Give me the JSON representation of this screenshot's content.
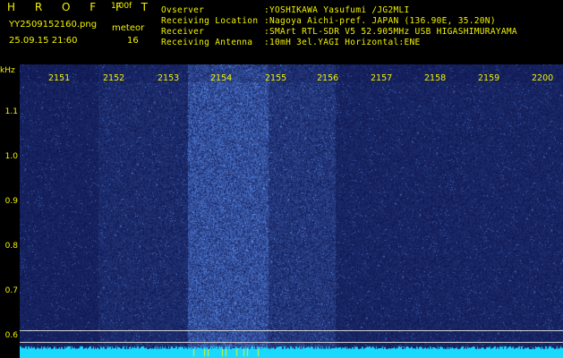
{
  "header": {
    "brand": "H R O F F T",
    "version": "1.00f",
    "filename": "YY2509152160.png",
    "mode": "meteor",
    "datetime": "25.09.15 21:60",
    "count": "16",
    "info": [
      {
        "label": "Ovserver",
        "value": ":YOSHIKAWA Yasufumi /JG2MLI"
      },
      {
        "label": "Receiving Location",
        "value": ":Nagoya Aichi-pref. JAPAN (136.90E, 35.20N)"
      },
      {
        "label": "Receiver",
        "value": ":SMArt RTL-SDR V5 52.905MHz USB HIGASHIMURAYAMA"
      },
      {
        "label": "Receiving Antenna",
        "value": ":10mH 3el.YAGI Horizontal:ENE"
      }
    ]
  },
  "spectrogram": {
    "y_unit": "kHz",
    "y_ticks": [
      "1.1",
      "1.0",
      "0.9",
      "0.8",
      "0.7",
      "0.6"
    ],
    "time_ticks": [
      "2151",
      "2152",
      "2153",
      "2154",
      "2155",
      "2156",
      "2157",
      "2158",
      "2159",
      "2200"
    ],
    "colors": {
      "text": "#f2f200",
      "background": "#00063a",
      "signal": "#4a8cff",
      "baseline": "#19d9ff"
    }
  }
}
